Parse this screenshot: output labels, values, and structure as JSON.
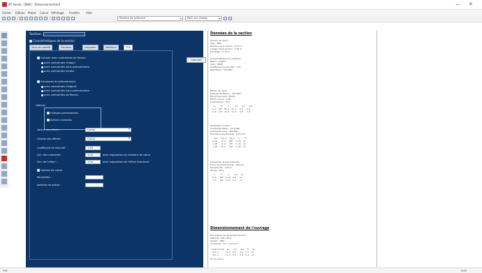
{
  "window": {
    "title": "BT Ascoli - [BBA] - Dimensionnement",
    "min_glyph": "—",
    "close_glyph": "✕"
  },
  "menu": [
    "Fichier",
    "Edition",
    "Projet",
    "Calcul",
    "Affichage",
    "Fenêtre",
    "Aide"
  ],
  "toolbar": {
    "combo1": "Position de présence",
    "combo2": "Plein sur charge"
  },
  "panel": {
    "header_label": "Section :",
    "subtitle": "Caractéristiques de la section",
    "tabs": [
      "Sens du profilé",
      "Sections",
      "Longueur",
      "Matériau",
      "TOL"
    ],
    "check1": "Calculer avec contraintes de flexion",
    "r1": "avec contraintes d'appui",
    "r2": "avec contraintes sans précontrainte",
    "r3": "avec contraintes limites",
    "calc_button": "Calculer",
    "check2": "Armatures de précontrainte",
    "r4": "avec contraintes d'appuis",
    "r5": "avec contraintes sans précontrainte",
    "r6": "avec contraintes de flexion",
    "group_label": "Options",
    "g1": "Charges permanentes",
    "g2": "Actions variables",
    "f1_label": "Valeur des efforts :",
    "f1_value": "Limite",
    "f2_label": "Origine des efforts :",
    "f2_value": "Calcul",
    "f3_label": "Coefficient de sécurité :",
    "f3_value": "1.50",
    "f4_label": "Lim. des moments :",
    "f4_value": "1.00",
    "f4_note": "avec majoration du moment de calcul",
    "f5_label": "Lim. de l'effort :",
    "f5_value": "1.00",
    "f5_note": "avec majoration de l'effort tranchant",
    "check3": "Options de calcul",
    "f6_label": "Paramètre :",
    "f6_value": "",
    "f7_label": "Nombre de points :",
    "f7_value": ""
  },
  "doc": {
    "h1": "Données de la section",
    "h2": "Dimensionnement de l'ouvrage",
    "lines_a": [
      "Section de calcul",
      "Type : BBA",
      "Hauteur de la section : 0.50 m",
      "Largeur de la section : 0.30 m",
      "Enrobage : 0.03 m"
    ],
    "lines_b": [
      "Caractéristiques du matériau",
      "Béton : C30/37",
      "Acier : B500",
      "Coefficient de sécurité : 1.50",
      "Résistance : 500 MPa"
    ],
    "lines_c": [
      "Efforts de calcul",
      "Moment de flexion : 125 kNm",
      "Effort tranchant : 85 kN",
      "Effort normal : 0 kN",
      "Combinaison : ELU"
    ],
    "table1": [
      "   N     M     V     As    As'   Ast",
      "  0.0  125  85.0  12.5   0.0   4.2",
      "  0.0  110  72.0  11.0   0.0   3.8"
    ],
    "lines_d": [
      "Vérification à l'ELS",
      "Contrainte béton : 12.4 MPa",
      "Contrainte acier : 285 MPa",
      "Ouverture des fissures : 0.20 mm"
    ],
    "table2": [
      "   pos   sig.b  sig.s   w    fl",
      "  0.50   12.4   285   0.20  ok",
      "  1.00   11.8   270   0.18  ok",
      "  1.50   10.2   251   0.16  ok"
    ],
    "lines_e": [
      "Armatures de précontrainte",
      "Force de précontrainte : 450 kN",
      "Excentricité : 0.15 m",
      "Pertes : 18 %"
    ],
    "table3": [
      "   x     P     e    sig   ok",
      "  0.0   450  0.15  9.8   ok",
      "  2.0   442  0.14  9.5   ok"
    ],
    "lines_f": [
      "Paramètres de dimensionnement",
      "Méthode : ELU / ELS",
      "Section : BBA",
      "Armatures : As = 12.5 cm²"
    ],
    "table4": [
      " Combinaison  As    As'   Ast  fl   ok",
      "  ELU-1      12.5  0.0   4.2  0.2  ok",
      "  ELS-1      11.0  0.0   3.8  0.2  ok"
    ],
    "footer": "Fin du calcul."
  },
  "status": {
    "left": "Prêt",
    "right": "NUM"
  },
  "colors": {
    "panel_bg": "#0c3466",
    "accent": "#c0302b"
  }
}
